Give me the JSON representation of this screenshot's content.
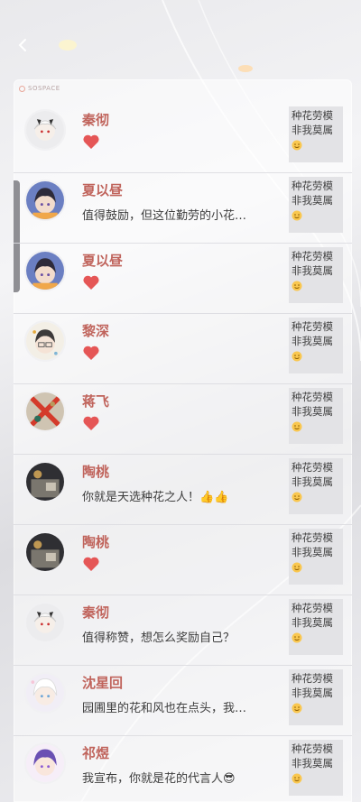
{
  "header": {
    "back_icon": "chevron-left-icon",
    "panel_tag": "SOSPACE"
  },
  "colors": {
    "name": "#c0645c",
    "heart": "#e55656",
    "tile_bg": "#e3e3e6"
  },
  "tile": {
    "line1": "种花劳模",
    "line2": "非我莫属",
    "icon": "smile-emoji-icon"
  },
  "rows": [
    {
      "name": "秦彻",
      "type": "heart",
      "avatar": "white-hair-horns"
    },
    {
      "name": "夏以昼",
      "type": "text",
      "message": "值得鼓励，但这位勤劳的小花…",
      "avatar": "dark-hair-boy"
    },
    {
      "name": "夏以昼",
      "type": "heart",
      "avatar": "dark-hair-boy"
    },
    {
      "name": "黎深",
      "type": "heart",
      "avatar": "glasses-boy"
    },
    {
      "name": "蒋飞",
      "type": "heart",
      "avatar": "red-x-pattern"
    },
    {
      "name": "陶桃",
      "type": "text",
      "message": "你就是天选种花之人！",
      "emoji": "👍👍",
      "avatar": "dark-photo"
    },
    {
      "name": "陶桃",
      "type": "heart",
      "avatar": "dark-photo"
    },
    {
      "name": "秦彻",
      "type": "text",
      "message": "值得称赞，想怎么奖励自己？",
      "avatar": "white-hair-horns"
    },
    {
      "name": "沈星回",
      "type": "text",
      "message": "园圃里的花和风也在点头，我…",
      "avatar": "white-hair-boy"
    },
    {
      "name": "祁煜",
      "type": "text",
      "message": "我宣布，你就是花的代言人",
      "emoji": "😎",
      "avatar": "purple-hair-boy"
    }
  ]
}
